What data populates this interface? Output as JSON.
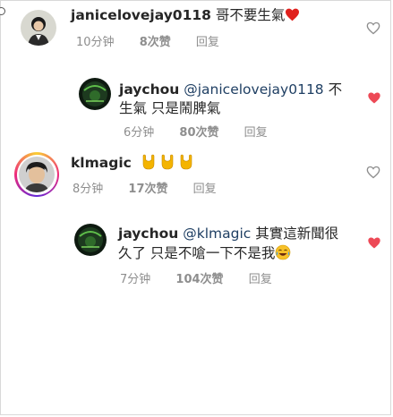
{
  "comments": [
    {
      "username": "janicelovejay0118",
      "text": "哥不要生氣",
      "emoji": "red-heart",
      "time": "10分钟",
      "likes": "8次赞",
      "reply": "回复",
      "liked": false
    },
    {
      "username": "jaychou",
      "mention": "@janicelovejay0118",
      "text_line1_tail": " 不",
      "text_line2": "生氣 只是鬧脾氣",
      "time": "6分钟",
      "likes": "80次赞",
      "reply": "回复",
      "liked": true
    },
    {
      "username": "klmagic",
      "emoji": "rock-hand x3",
      "time": "8分钟",
      "likes": "17次赞",
      "reply": "回复",
      "liked": false
    },
    {
      "username": "jaychou",
      "mention": "@klmagic",
      "text_line1_tail": " 其實這新聞很",
      "text_line2": "久了 只是不嗆一下不是我",
      "emoji": "tears-of-joy",
      "time": "7分钟",
      "likes": "104次赞",
      "reply": "回复",
      "liked": true
    }
  ],
  "colors": {
    "liked_heart": "#ed4956",
    "unliked_heart": "#8e8e8e",
    "mention": "#1f3f63",
    "meta": "#8e8e8e"
  }
}
